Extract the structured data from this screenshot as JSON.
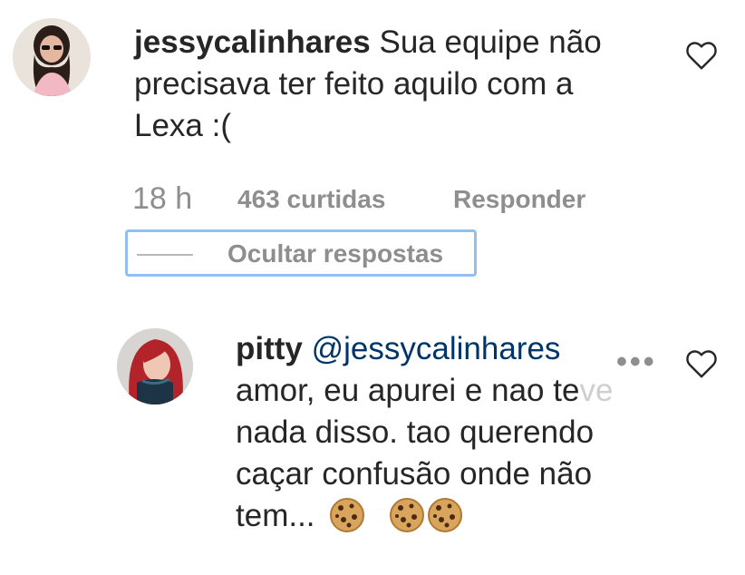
{
  "comments": [
    {
      "username": "jessycalinhares",
      "line1": "Sua equipe não",
      "line2": "precisava ter feito aquilo com a",
      "line3": "Lexa :(",
      "time": "18 h",
      "likes": "463 curtidas",
      "reply_label": "Responder",
      "hide_replies_label": "Ocultar respostas"
    }
  ],
  "reply": {
    "username": "pitty",
    "mention": "@jessycalinhares",
    "line1_a": "amor, eu apurei e nao te",
    "line1_b": "ve",
    "line2": "nada disso. tao querendo",
    "line3": "caçar confusão onde não",
    "line4": "tem...",
    "more_label": "•••"
  },
  "icons": {
    "like": "heart-outline-icon",
    "emoji": "cookie-emoji"
  },
  "colors": {
    "text": "#262626",
    "secondary": "#8e8e8e",
    "mention": "#003569",
    "focus_ring": "#90bff0"
  }
}
